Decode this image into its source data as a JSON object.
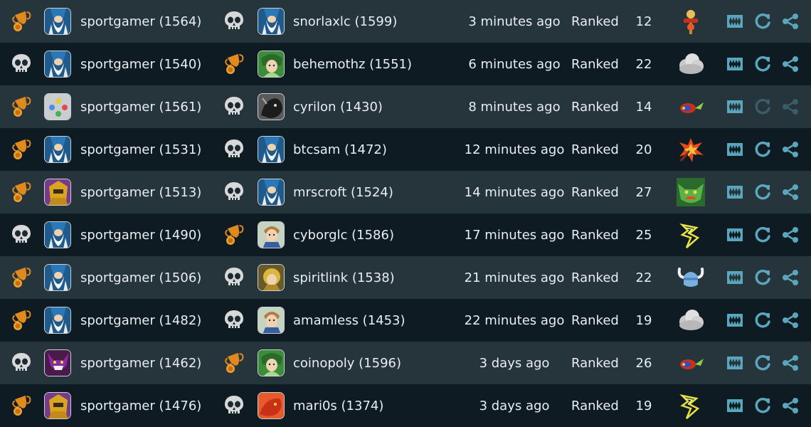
{
  "colors": {
    "row_light": "#26343c",
    "row_dark": "#0e1b23",
    "text": "#e8eef1",
    "action_icon": "#5aa7bd",
    "trophy": "#e08a1e",
    "skull": "#d8d8d8"
  },
  "games": [
    {
      "p1_result": "win",
      "p1_avatar": "wizard",
      "p1": "sportgamer (1564)",
      "p2_result": "loss",
      "p2_avatar": "wizard",
      "p2": "snorlaxlc (1599)",
      "time": "3 minutes ago",
      "mode": "Ranked",
      "turns": "12",
      "map_icon": "totem",
      "actions_enabled": true
    },
    {
      "p1_result": "loss",
      "p1_avatar": "wizard",
      "p1": "sportgamer (1540)",
      "p2_result": "win",
      "p2_avatar": "elf",
      "p2": "behemothz (1551)",
      "time": "6 minutes ago",
      "mode": "Ranked",
      "turns": "22",
      "map_icon": "cloud",
      "actions_enabled": true
    },
    {
      "p1_result": "win",
      "p1_avatar": "buttons",
      "p1": "sportgamer (1561)",
      "p2_result": "loss",
      "p2_avatar": "panther",
      "p2": "cyrilon (1430)",
      "time": "8 minutes ago",
      "mode": "Ranked",
      "turns": "14",
      "map_icon": "rocket",
      "actions_enabled": false
    },
    {
      "p1_result": "win",
      "p1_avatar": "wizard",
      "p1": "sportgamer (1531)",
      "p2_result": "loss",
      "p2_avatar": "wizard",
      "p2": "btcsam (1472)",
      "time": "12 minutes ago",
      "mode": "Ranked",
      "turns": "20",
      "map_icon": "explosion",
      "actions_enabled": true
    },
    {
      "p1_result": "win",
      "p1_avatar": "knight",
      "p1": "sportgamer (1513)",
      "p2_result": "loss",
      "p2_avatar": "wizard",
      "p2": "mrscroft (1524)",
      "time": "14 minutes ago",
      "mode": "Ranked",
      "turns": "27",
      "map_icon": "orc",
      "actions_enabled": true
    },
    {
      "p1_result": "loss",
      "p1_avatar": "wizard",
      "p1": "sportgamer (1490)",
      "p2_result": "win",
      "p2_avatar": "boy",
      "p2": "cyborglc (1586)",
      "time": "17 minutes ago",
      "mode": "Ranked",
      "turns": "25",
      "map_icon": "lightning",
      "actions_enabled": true
    },
    {
      "p1_result": "win",
      "p1_avatar": "wizard",
      "p1": "sportgamer (1506)",
      "p2_result": "loss",
      "p2_avatar": "golden",
      "p2": "spiritlink (1538)",
      "time": "21 minutes ago",
      "mode": "Ranked",
      "turns": "22",
      "map_icon": "helmet",
      "actions_enabled": true
    },
    {
      "p1_result": "win",
      "p1_avatar": "wizard",
      "p1": "sportgamer (1482)",
      "p2_result": "loss",
      "p2_avatar": "boy",
      "p2": "amamless (1453)",
      "time": "22 minutes ago",
      "mode": "Ranked",
      "turns": "19",
      "map_icon": "cloud",
      "actions_enabled": true
    },
    {
      "p1_result": "loss",
      "p1_avatar": "demon",
      "p1": "sportgamer (1462)",
      "p2_result": "win",
      "p2_avatar": "elf",
      "p2": "coinopoly (1596)",
      "time": "3 days ago",
      "mode": "Ranked",
      "turns": "26",
      "map_icon": "rocket",
      "actions_enabled": true
    },
    {
      "p1_result": "win",
      "p1_avatar": "knight",
      "p1": "sportgamer (1476)",
      "p2_result": "loss",
      "p2_avatar": "dragon",
      "p2": "mari0s (1374)",
      "time": "3 days ago",
      "mode": "Ranked",
      "turns": "19",
      "map_icon": "lightning",
      "actions_enabled": true
    }
  ]
}
